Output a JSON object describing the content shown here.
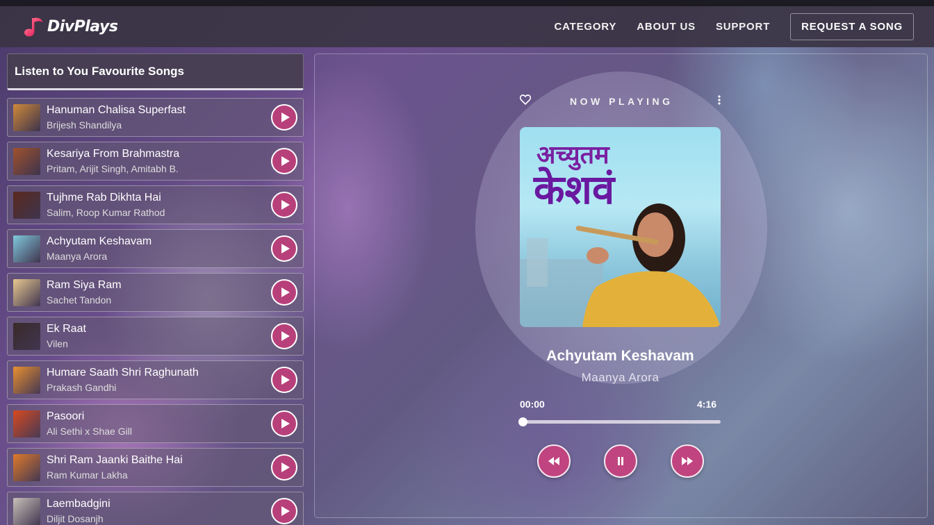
{
  "app": {
    "name": "DivPlays"
  },
  "nav": {
    "category": "CATEGORY",
    "about": "ABOUT US",
    "support": "SUPPORT",
    "request": "REQUEST A SONG"
  },
  "sidebar": {
    "heading": "Listen to You Favourite Songs",
    "songs": [
      {
        "title": "Hanuman Chalisa Superfast",
        "artist": "Brijesh Shandilya",
        "thumb": "#d08a3a"
      },
      {
        "title": "Kesariya From Brahmastra",
        "artist": "Pritam, Arijit Singh, Amitabh B.",
        "thumb": "#a0522d"
      },
      {
        "title": "Tujhme Rab Dikhta Hai",
        "artist": "Salim, Roop Kumar Rathod",
        "thumb": "#5a2a1e"
      },
      {
        "title": "Achyutam Keshavam",
        "artist": "Maanya Arora",
        "thumb": "#7fc9dc"
      },
      {
        "title": "Ram Siya Ram",
        "artist": "Sachet Tandon",
        "thumb": "#e8c890"
      },
      {
        "title": "Ek Raat",
        "artist": "Vilen",
        "thumb": "#3a2a28"
      },
      {
        "title": "Humare Saath Shri Raghunath",
        "artist": "Prakash Gandhi",
        "thumb": "#e89030"
      },
      {
        "title": "Pasoori",
        "artist": "Ali Sethi x Shae Gill",
        "thumb": "#d84a20"
      },
      {
        "title": "Shri Ram Jaanki Baithe Hai",
        "artist": "Ram Kumar Lakha",
        "thumb": "#e07a2a"
      },
      {
        "title": "Laembadgini",
        "artist": "Diljit Dosanjh",
        "thumb": "#c8c0b8"
      }
    ]
  },
  "player": {
    "label": "NOW PLAYING",
    "cover_line1": "अच्युतम",
    "cover_line2": "केशवं",
    "title": "Achyutam Keshavam",
    "artist": "Maanya Arora",
    "current_time": "00:00",
    "total_time": "4:16",
    "progress": 0,
    "accent": "#c0447f"
  },
  "icons": {
    "like": "heart-icon",
    "menu": "more-vertical-icon",
    "prev": "rewind-icon",
    "pause": "pause-icon",
    "next": "fast-forward-icon",
    "play": "play-icon"
  }
}
